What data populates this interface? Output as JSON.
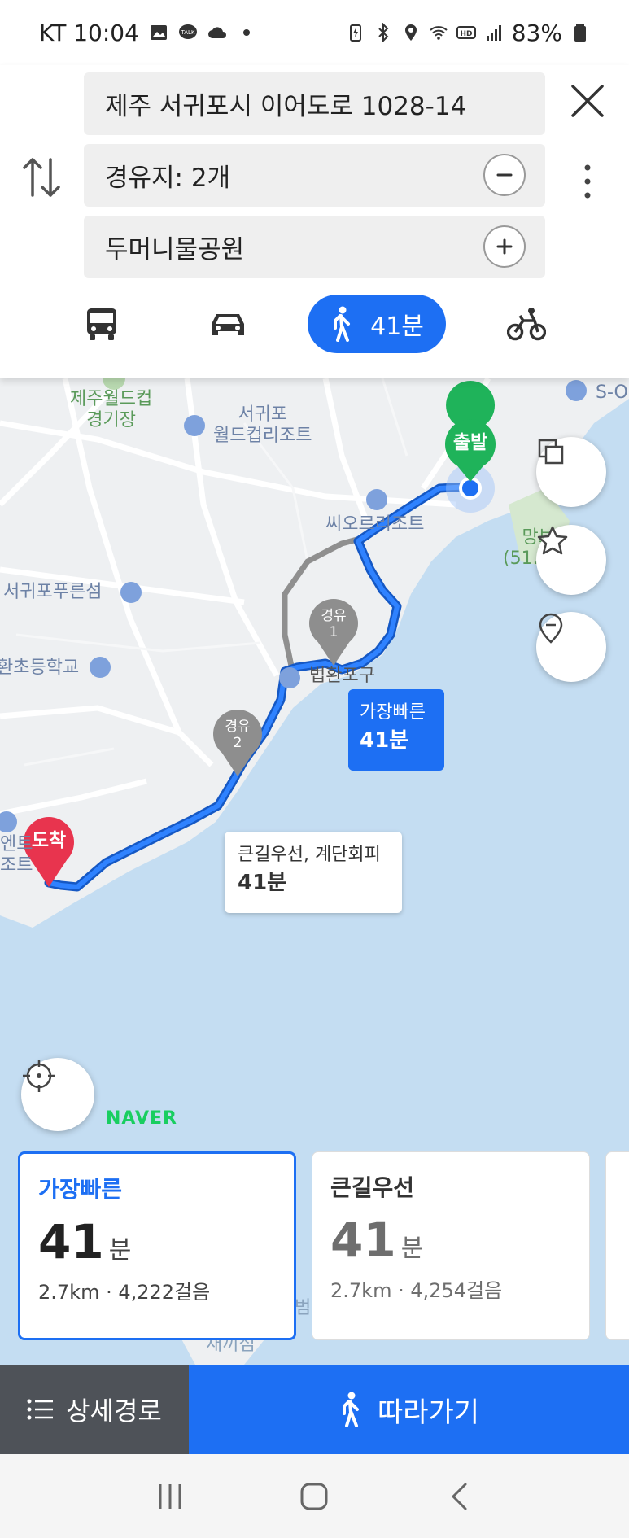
{
  "status_bar": {
    "carrier_time": "KT 10:04",
    "battery": "83%"
  },
  "route_header": {
    "origin": "제주 서귀포시 이어도로 1028-14",
    "waypoints": "경유지: 2개",
    "destination": "두머니물공원",
    "modes": {
      "walk_time": "41분"
    }
  },
  "map": {
    "labels": {
      "stadium": "제주월드컵\n경기장",
      "resort1": "서귀포\n월드컵리조트",
      "resort2": "씨오르리조트",
      "island": "서귀포푸른섬",
      "school": "환초등학교",
      "port": "법환포구",
      "peak": "망보\n(51.1m)",
      "s_oil": "S-O",
      "ent": "엔트\n조트",
      "bottom": "새끼섬",
      "bottom2": "범"
    },
    "markers": {
      "start": "출발",
      "end": "도착",
      "way1_top": "경유",
      "way1_num": "1",
      "way2_top": "경유",
      "way2_num": "2"
    },
    "tags": {
      "fastest_label": "가장빠른",
      "fastest_time": "41분",
      "alt_label": "큰길우선, 계단회피",
      "alt_time": "41분"
    },
    "brand": "NAVER"
  },
  "route_cards": [
    {
      "title": "가장빠른",
      "time": "41",
      "unit": "분",
      "info": "2.7km · 4,222걸음"
    },
    {
      "title": "큰길우선",
      "time": "41",
      "unit": "분",
      "info": "2.7km · 4,254걸음"
    }
  ],
  "bottom_bar": {
    "detail": "상세경로",
    "follow": "따라가기"
  },
  "colors": {
    "accent": "#1d6ff3",
    "start_marker": "#1fb35a",
    "end_marker": "#e8344e",
    "water": "#c4ddf2"
  }
}
